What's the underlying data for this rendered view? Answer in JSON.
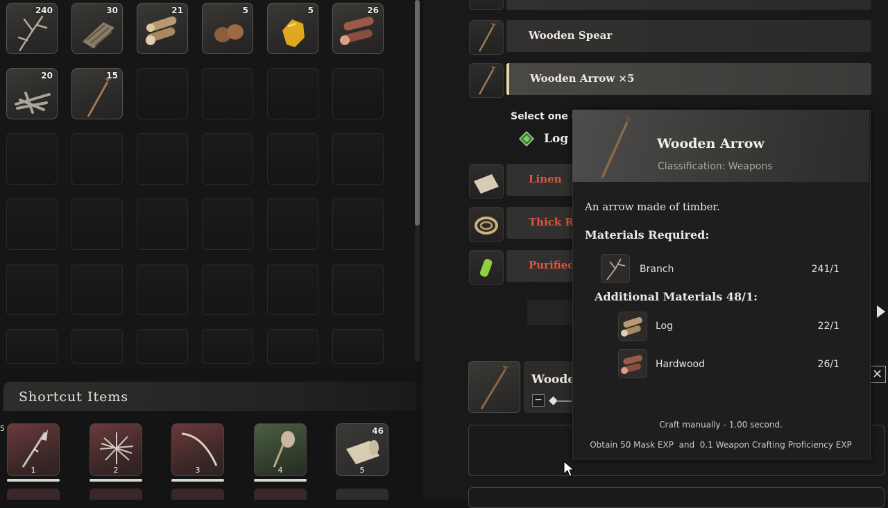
{
  "inventory": {
    "slots": [
      {
        "icon": "branch-icon",
        "count": "240"
      },
      {
        "icon": "bark-icon",
        "count": "30"
      },
      {
        "icon": "log-icon",
        "count": "21"
      },
      {
        "icon": "nut-icon",
        "count": "5"
      },
      {
        "icon": "resin-icon",
        "count": "5"
      },
      {
        "icon": "hardwood-icon",
        "count": "26"
      },
      {
        "icon": "sticks-bundle-icon",
        "count": "20"
      },
      {
        "icon": "wooden-spear-icon",
        "count": "15"
      }
    ]
  },
  "shortcut": {
    "title": "Shortcut Items",
    "partial_left_count": "5",
    "items": [
      {
        "icon": "spear-icon",
        "num": "1",
        "tint": "red"
      },
      {
        "icon": "twig-nest-icon",
        "num": "2",
        "tint": "red"
      },
      {
        "icon": "bow-icon",
        "num": "3",
        "tint": "red"
      },
      {
        "icon": "torch-icon",
        "num": "4",
        "tint": "green"
      },
      {
        "icon": "linen-roll-icon",
        "num": "5",
        "tint": "plain",
        "count": "46"
      }
    ]
  },
  "crafting": {
    "recipes": [
      {
        "label": "Wooden Spear"
      },
      {
        "label": "Wooden Arrow ×5"
      }
    ],
    "select_prompt": "Select one or",
    "selected_option": "Log",
    "materials_list": [
      {
        "label": "Linen"
      },
      {
        "label": "Thick Re"
      },
      {
        "label": "Purified"
      }
    ],
    "craft_name_partial": "Woode"
  },
  "tooltip": {
    "title": "Wooden Arrow",
    "classification": "Classification: Weapons",
    "description": "An arrow made of timber.",
    "materials_header": "Materials Required:",
    "materials": [
      {
        "name": "Branch",
        "amount": "241/1"
      }
    ],
    "additional_header": "Additional Materials 48/1:",
    "additional": [
      {
        "name": "Log",
        "amount": "22/1"
      },
      {
        "name": "Hardwood",
        "amount": "26/1"
      }
    ],
    "craft_time": "Craft manually - 1.00 second.",
    "rewards": "Obtain 50 Mask EXP  and  0.1 Weapon Crafting Proficiency EXP"
  },
  "colors": {
    "accent_red": "#e0543f",
    "selected_gold": "#e8d8a8",
    "option_green": "#6fbf5a"
  }
}
